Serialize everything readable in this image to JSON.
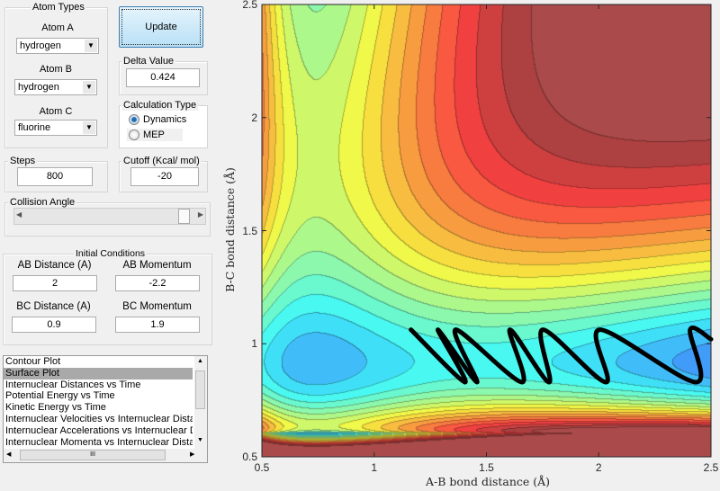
{
  "atom_types": {
    "title": "Atom Types",
    "atom_a": {
      "label": "Atom A",
      "value": "hydrogen"
    },
    "atom_b": {
      "label": "Atom B",
      "value": "hydrogen"
    },
    "atom_c": {
      "label": "Atom C",
      "value": "fluorine"
    }
  },
  "update_label": "Update",
  "delta": {
    "title": "Delta Value",
    "value": "0.424"
  },
  "calc_type": {
    "title": "Calculation Type",
    "options": [
      "Dynamics",
      "MEP"
    ],
    "selected": "Dynamics"
  },
  "steps": {
    "title": "Steps",
    "value": "800"
  },
  "cutoff": {
    "title": "Cutoff (Kcal/ mol)",
    "value": "-20"
  },
  "collision": {
    "title": "Collision Angle",
    "slider_fraction": 0.98
  },
  "initial": {
    "title": "Initial Conditions",
    "ab_dist_label": "AB Distance (A)",
    "ab_dist": "2",
    "ab_mom_label": "AB Momentum",
    "ab_mom": "-2.2",
    "bc_dist_label": "BC Distance (A)",
    "bc_dist": "0.9",
    "bc_mom_label": "BC Momentum",
    "bc_mom": "1.9"
  },
  "plot_list": {
    "items": [
      "Contour Plot",
      "Surface Plot",
      "Internuclear Distances vs Time",
      "Potential Energy vs Time",
      "Kinetic Energy vs Time",
      "Internuclear Velocities vs Internuclear Distance",
      "Internuclear Accelerations vs Internuclear Distance",
      "Internuclear Momenta vs Internuclear Distance"
    ],
    "selected": "Surface Plot",
    "hscroll_glyph": "III"
  },
  "chart_data": {
    "type": "contour",
    "xlabel": "A-B bond distance (Å)",
    "ylabel": "B-C bond distance (Å)",
    "xlim": [
      0.5,
      2.5
    ],
    "ylim": [
      0.5,
      2.5
    ],
    "xticks": [
      "0.5",
      "1",
      "1.5",
      "2",
      "2.5"
    ],
    "yticks": [
      "0.5",
      "1",
      "1.5",
      "2",
      "2.5"
    ],
    "colormap": "jet",
    "cutoff_color": "#ab4a4a",
    "trajectory": {
      "color": "#000000",
      "x": [
        1.164,
        1.405,
        1.284,
        1.458,
        1.364,
        1.658,
        1.605,
        1.779,
        1.752,
        2.032,
        2.006,
        2.433,
        2.407,
        2.5
      ],
      "y": [
        1.062,
        0.83,
        1.062,
        0.83,
        1.062,
        0.83,
        1.062,
        0.83,
        1.062,
        0.83,
        1.062,
        0.83,
        1.062,
        1.02
      ]
    }
  }
}
